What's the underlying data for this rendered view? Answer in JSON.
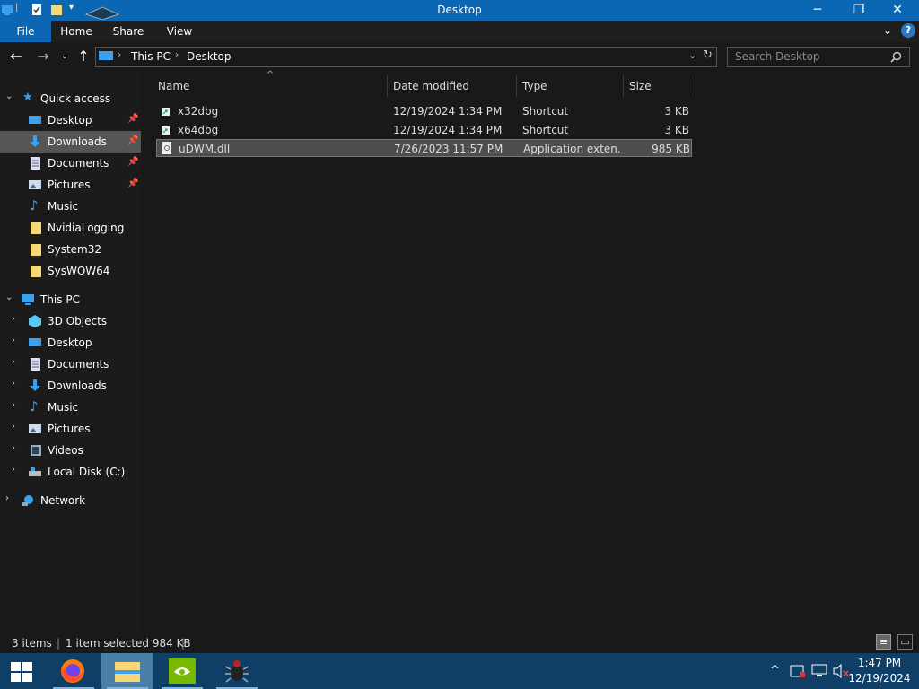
{
  "window": {
    "title": "Desktop",
    "minimize_icon": "minimize-icon",
    "maximize_icon": "maximize-icon",
    "close_icon": "close-icon"
  },
  "ribbon": {
    "tabs": [
      "File",
      "Home",
      "Share",
      "View"
    ]
  },
  "address": {
    "breadcrumb": [
      "This PC",
      "Desktop"
    ],
    "search_placeholder": "Search Desktop"
  },
  "sidebar": {
    "quick_access_label": "Quick access",
    "quick_access": [
      {
        "label": "Desktop",
        "icon": "desktop-icon",
        "pinned": true
      },
      {
        "label": "Downloads",
        "icon": "download-icon",
        "pinned": true,
        "selected": true
      },
      {
        "label": "Documents",
        "icon": "documents-icon",
        "pinned": true
      },
      {
        "label": "Pictures",
        "icon": "pictures-icon",
        "pinned": true
      },
      {
        "label": "Music",
        "icon": "music-icon",
        "pinned": false
      },
      {
        "label": "NvidiaLogging",
        "icon": "folder-icon",
        "pinned": false
      },
      {
        "label": "System32",
        "icon": "folder-icon",
        "pinned": false
      },
      {
        "label": "SysWOW64",
        "icon": "folder-icon",
        "pinned": false
      }
    ],
    "this_pc_label": "This PC",
    "this_pc": [
      {
        "label": "3D Objects",
        "icon": "3d-objects-icon"
      },
      {
        "label": "Desktop",
        "icon": "desktop-icon"
      },
      {
        "label": "Documents",
        "icon": "documents-icon"
      },
      {
        "label": "Downloads",
        "icon": "download-icon"
      },
      {
        "label": "Music",
        "icon": "music-icon"
      },
      {
        "label": "Pictures",
        "icon": "pictures-icon"
      },
      {
        "label": "Videos",
        "icon": "videos-icon"
      },
      {
        "label": "Local Disk (C:)",
        "icon": "drive-icon"
      }
    ],
    "network_label": "Network"
  },
  "files": {
    "columns": [
      "Name",
      "Date modified",
      "Type",
      "Size"
    ],
    "rows": [
      {
        "name": "x32dbg",
        "date": "12/19/2024 1:34 PM",
        "type": "Shortcut",
        "size": "3 KB",
        "icon": "shortcut-icon"
      },
      {
        "name": "x64dbg",
        "date": "12/19/2024 1:34 PM",
        "type": "Shortcut",
        "size": "3 KB",
        "icon": "shortcut-icon"
      },
      {
        "name": "uDWM.dll",
        "date": "7/26/2023 11:57 PM",
        "type": "Application exten...",
        "size": "985 KB",
        "icon": "dll-file-icon",
        "selected": true
      }
    ]
  },
  "status": {
    "item_count": "3 items",
    "selection": "1 item selected  984 KB"
  },
  "taskbar": {
    "apps": [
      "firefox-icon",
      "file-explorer-icon",
      "nvidia-icon",
      "debugger-bug-icon"
    ],
    "clock_time": "1:47 PM",
    "clock_date": "12/19/2024"
  },
  "colors": {
    "accent": "#0b66b3",
    "taskbar": "#0f3f66",
    "background": "#191919",
    "selection": "#4d4d4d"
  }
}
